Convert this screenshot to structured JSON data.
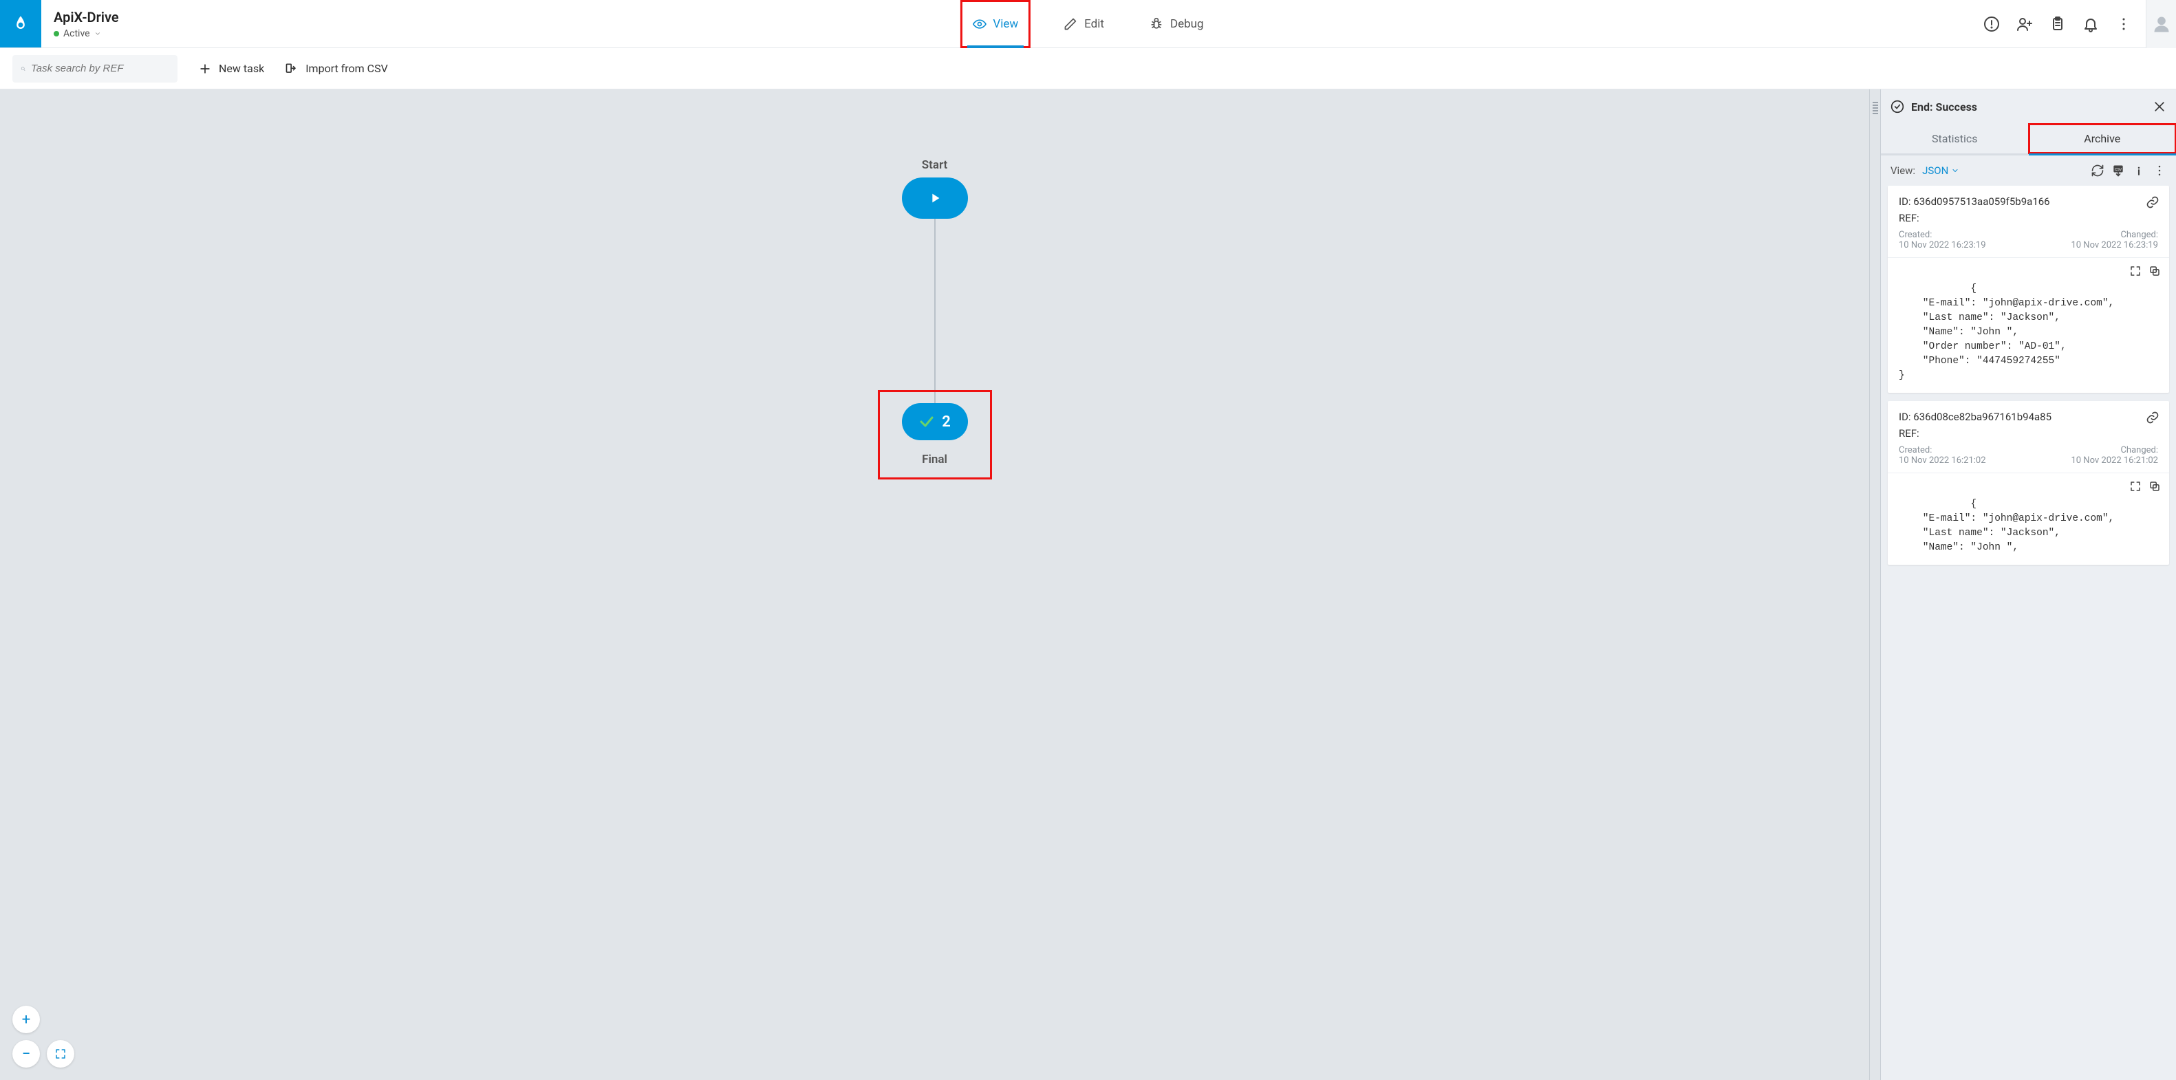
{
  "header": {
    "title": "ApiX-Drive",
    "status": "Active"
  },
  "modes": {
    "view": "View",
    "edit": "Edit",
    "debug": "Debug"
  },
  "subbar": {
    "search_placeholder": "Task search by REF",
    "new_task": "New task",
    "import_csv": "Import from CSV"
  },
  "canvas": {
    "start_label": "Start",
    "final_label": "Final",
    "final_count": "2"
  },
  "panel": {
    "title": "End: Success",
    "tabs": {
      "statistics": "Statistics",
      "archive": "Archive"
    },
    "view_label": "View:",
    "view_value": "JSON"
  },
  "cards": [
    {
      "id_label": "ID:",
      "id": "636d0957513aa059f5b9a166",
      "ref_label": "REF:",
      "ref": "",
      "created_label": "Created:",
      "created": "10 Nov 2022 16:23:19",
      "changed_label": "Changed:",
      "changed": "10 Nov 2022 16:23:19",
      "json": "{\n    \"E-mail\": \"john@apix-drive.com\",\n    \"Last name\": \"Jackson\",\n    \"Name\": \"John \",\n    \"Order number\": \"AD-01\",\n    \"Phone\": \"447459274255\"\n}"
    },
    {
      "id_label": "ID:",
      "id": "636d08ce82ba967161b94a85",
      "ref_label": "REF:",
      "ref": "",
      "created_label": "Created:",
      "created": "10 Nov 2022 16:21:02",
      "changed_label": "Changed:",
      "changed": "10 Nov 2022 16:21:02",
      "json": "{\n    \"E-mail\": \"john@apix-drive.com\",\n    \"Last name\": \"Jackson\",\n    \"Name\": \"John \","
    }
  ]
}
